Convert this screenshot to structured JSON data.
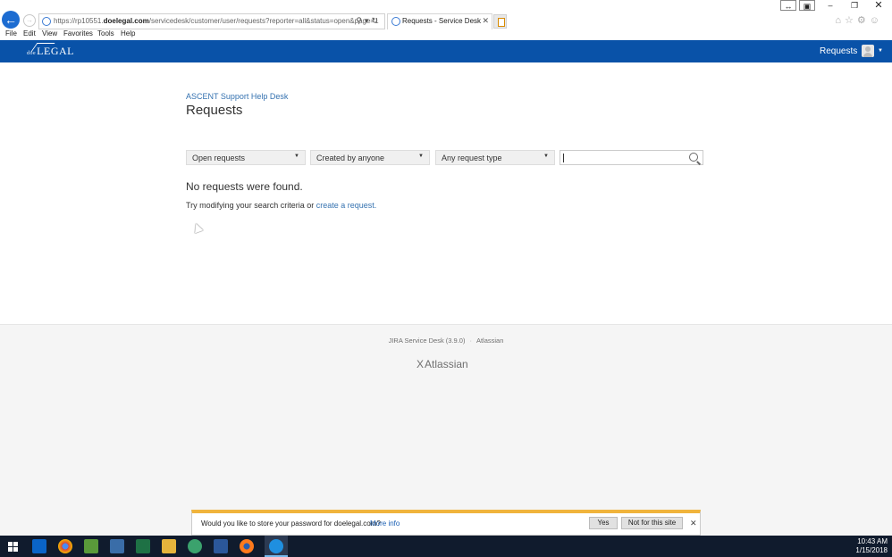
{
  "browser": {
    "url_prefix": "https://rp10551.",
    "url_domain": "doelegal.com",
    "url_suffix": "/servicedesk/customer/user/requests?reporter=all&status=open&page=1",
    "tab_title": "Requests - Service Desk",
    "menu": [
      "File",
      "Edit",
      "View",
      "Favorites",
      "Tools",
      "Help"
    ]
  },
  "header": {
    "logo_small": "doe",
    "logo_main": "LEGAL",
    "nav_requests": "Requests"
  },
  "main": {
    "breadcrumb": "ASCENT Support Help Desk",
    "title": "Requests",
    "filters": [
      {
        "label": "Open requests"
      },
      {
        "label": "Created by anyone"
      },
      {
        "label": "Any request type"
      }
    ],
    "search_value": "",
    "empty_title": "No requests were found.",
    "empty_hint": "Try modifying your search criteria or ",
    "empty_link": "create a request."
  },
  "footer": {
    "product": "JIRA Service Desk (3.9.0)",
    "vendor": "Atlassian",
    "logo": "Atlassian"
  },
  "notification": {
    "message": "Would you like to store your password for doelegal.com?",
    "more_info": "More info",
    "yes": "Yes",
    "no": "Not for this site"
  },
  "taskbar": {
    "time": "10:43 AM",
    "date": "1/15/2018"
  },
  "colors": {
    "header_bg": "#0952a8",
    "link": "#3572b0",
    "notif_accent": "#f0b43c",
    "taskbar_bg": "#101b2d"
  }
}
